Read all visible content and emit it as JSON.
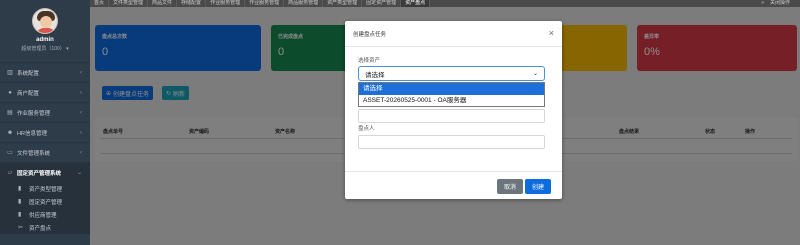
{
  "sidebar": {
    "admin_name": "admin",
    "admin_role": "超级管理员（100）",
    "items": [
      {
        "label": "系统配置",
        "icon": "bank-icon"
      },
      {
        "label": "商户配置",
        "icon": "user-icon"
      },
      {
        "label": "作业服务管理",
        "icon": "briefcase-icon"
      },
      {
        "label": "HR信息管理",
        "icon": "person-icon"
      },
      {
        "label": "文件管理系统",
        "icon": "folder-icon"
      },
      {
        "label": "固定资产管理系统",
        "icon": "folder-open-icon"
      }
    ],
    "subitems": [
      {
        "label": "资产类型管理",
        "icon": "file-icon"
      },
      {
        "label": "固定资产管理",
        "icon": "file-icon"
      },
      {
        "label": "供应商管理",
        "icon": "file-icon"
      },
      {
        "label": "资产盘点",
        "icon": "scissors-icon"
      }
    ]
  },
  "topbar": {
    "tabs": [
      "首页",
      "文件类型管理",
      "商品文件",
      "存储配置",
      "作业服务管理",
      "作业服务管理",
      "商品服务管理",
      "资产类型管理",
      "固定资产管理",
      "资产盘点"
    ],
    "right": [
      "关闭操作"
    ]
  },
  "cards": [
    {
      "label": "盘点总次数",
      "value": "0",
      "color": "#0f6cdf"
    },
    {
      "label": "已完成盘点",
      "value": "0",
      "color": "#168a52"
    },
    {
      "label": "",
      "value": "",
      "color": "#f5b800"
    },
    {
      "label": "差异率",
      "value": "0%",
      "color": "#d93947"
    }
  ],
  "toolbar": {
    "create_label": "创建盘点任务",
    "refresh_label": "刷新"
  },
  "table": {
    "columns": [
      "盘点单号",
      "资产编码",
      "资产名称",
      "",
      "",
      "",
      "盘点结果",
      "状态",
      "操作"
    ]
  },
  "modal": {
    "title": "创建盘点任务",
    "select_label": "选择资产",
    "select_value": "请选择",
    "options": [
      "请选择",
      "ASSET-20260525-0001 - OA服务器"
    ],
    "checker_label": "盘点人",
    "cancel_label": "取消",
    "create_label": "创建"
  }
}
